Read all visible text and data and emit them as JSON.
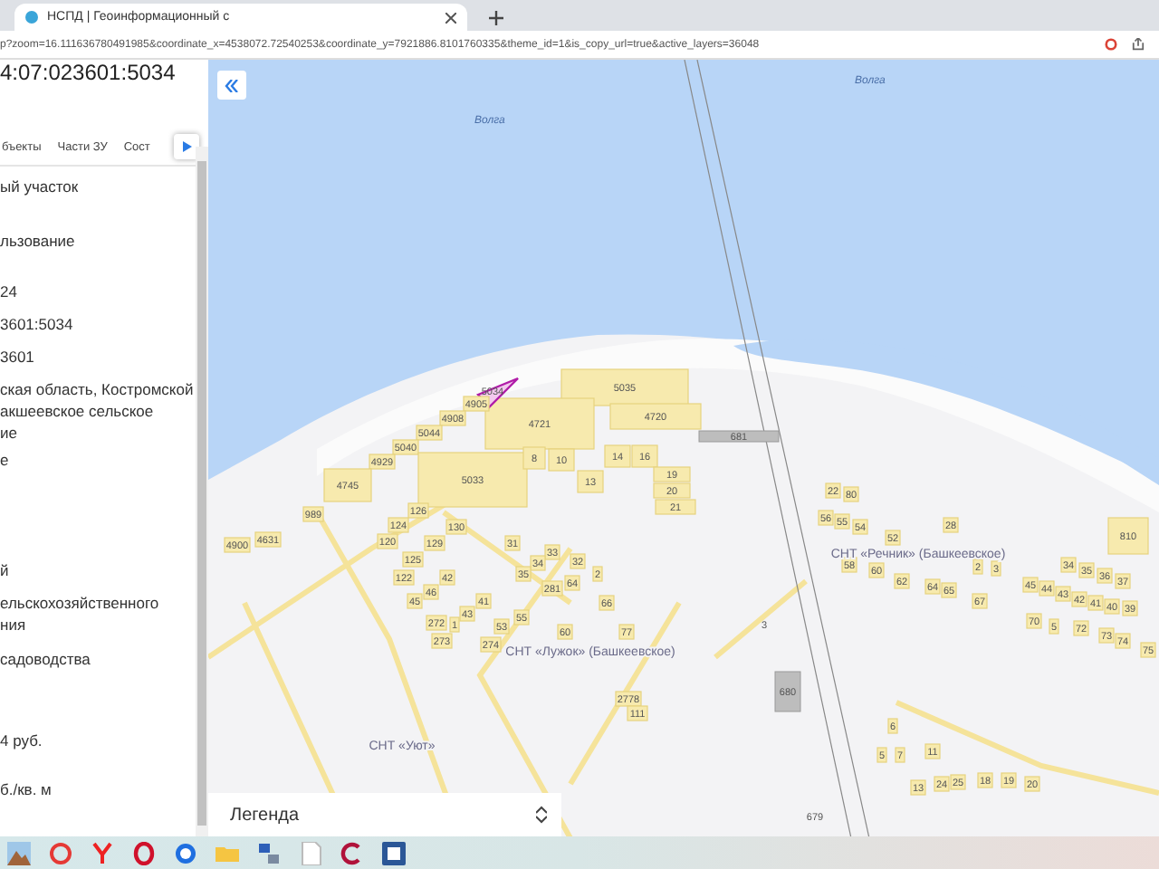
{
  "browser": {
    "tab_title": "НСПД | Геоинформационный с",
    "url": "p?zoom=16.111636780491985&coordinate_x=4538072.72540253&coordinate_y=7921886.8101760335&theme_id=1&is_copy_url=true&active_layers=36048"
  },
  "panel": {
    "title": "4:07:023601:5034",
    "tabs": [
      {
        "label": "бъекты"
      },
      {
        "label": "Части ЗУ"
      },
      {
        "label": "Сост"
      }
    ],
    "rows": [
      {
        "lines": [
          "ый участок"
        ]
      },
      {
        "lines": [
          "льзование"
        ]
      },
      {
        "lines": [
          "24"
        ]
      },
      {
        "lines": [
          "3601:5034"
        ]
      },
      {
        "lines": [
          "3601"
        ]
      },
      {
        "lines": [
          "ская область, Костромской",
          "акшеевское сельское",
          "ие"
        ]
      },
      {
        "lines": [
          "е"
        ]
      },
      {
        "lines": [
          "й"
        ]
      },
      {
        "lines": [
          "ельскохозяйственного",
          "ния"
        ]
      },
      {
        "lines": [
          "садоводства"
        ]
      },
      {
        "lines": [
          "4 руб."
        ]
      },
      {
        "lines": [
          "б./кв. м"
        ]
      }
    ]
  },
  "map": {
    "water_labels": [
      "Волга",
      "Волга"
    ],
    "parcels": [
      {
        "label": "5035",
        "kind": "parcel"
      },
      {
        "label": "4720",
        "kind": "parcel"
      },
      {
        "label": "4721",
        "kind": "parcel"
      },
      {
        "label": "5034",
        "kind": "selected"
      },
      {
        "label": "4905",
        "kind": "parcel"
      },
      {
        "label": "4908",
        "kind": "parcel"
      },
      {
        "label": "5044",
        "kind": "parcel"
      },
      {
        "label": "5040",
        "kind": "parcel"
      },
      {
        "label": "4929",
        "kind": "parcel"
      },
      {
        "label": "4745",
        "kind": "parcel"
      },
      {
        "label": "5033",
        "kind": "parcel"
      },
      {
        "label": "8",
        "kind": "parcel"
      },
      {
        "label": "10",
        "kind": "parcel"
      },
      {
        "label": "13",
        "kind": "parcel"
      },
      {
        "label": "14",
        "kind": "parcel"
      },
      {
        "label": "16",
        "kind": "parcel"
      },
      {
        "label": "19",
        "kind": "parcel"
      },
      {
        "label": "20",
        "kind": "parcel"
      },
      {
        "label": "21",
        "kind": "parcel"
      },
      {
        "label": "681",
        "kind": "structure"
      },
      {
        "label": "989",
        "kind": "parcel"
      },
      {
        "label": "4631",
        "kind": "parcel"
      },
      {
        "label": "4900",
        "kind": "parcel"
      },
      {
        "label": "126",
        "kind": "parcel"
      },
      {
        "label": "124",
        "kind": "parcel"
      },
      {
        "label": "120",
        "kind": "parcel"
      },
      {
        "label": "130",
        "kind": "parcel"
      },
      {
        "label": "129",
        "kind": "parcel"
      },
      {
        "label": "31",
        "kind": "parcel"
      },
      {
        "label": "33",
        "kind": "parcel"
      },
      {
        "label": "34",
        "kind": "parcel"
      },
      {
        "label": "32",
        "kind": "parcel"
      },
      {
        "label": "35",
        "kind": "parcel"
      },
      {
        "label": "281",
        "kind": "parcel"
      },
      {
        "label": "64",
        "kind": "parcel"
      },
      {
        "label": "2",
        "kind": "parcel"
      },
      {
        "label": "66",
        "kind": "parcel"
      },
      {
        "label": "125",
        "kind": "parcel"
      },
      {
        "label": "122",
        "kind": "parcel"
      },
      {
        "label": "42",
        "kind": "parcel"
      },
      {
        "label": "46",
        "kind": "parcel"
      },
      {
        "label": "45",
        "kind": "parcel"
      },
      {
        "label": "41",
        "kind": "parcel"
      },
      {
        "label": "43",
        "kind": "parcel"
      },
      {
        "label": "272",
        "kind": "parcel"
      },
      {
        "label": "1",
        "kind": "parcel"
      },
      {
        "label": "273",
        "kind": "parcel"
      },
      {
        "label": "274",
        "kind": "parcel"
      },
      {
        "label": "53",
        "kind": "parcel"
      },
      {
        "label": "55",
        "kind": "parcel"
      },
      {
        "label": "60",
        "kind": "parcel"
      },
      {
        "label": "77",
        "kind": "parcel"
      },
      {
        "label": "22",
        "kind": "parcel"
      },
      {
        "label": "80",
        "kind": "parcel"
      },
      {
        "label": "56",
        "kind": "parcel"
      },
      {
        "label": "55",
        "kind": "parcel"
      },
      {
        "label": "54",
        "kind": "parcel"
      },
      {
        "label": "52",
        "kind": "parcel"
      },
      {
        "label": "28",
        "kind": "parcel"
      },
      {
        "label": "58",
        "kind": "parcel"
      },
      {
        "label": "60",
        "kind": "parcel"
      },
      {
        "label": "62",
        "kind": "parcel"
      },
      {
        "label": "64",
        "kind": "parcel"
      },
      {
        "label": "65",
        "kind": "parcel"
      },
      {
        "label": "67",
        "kind": "parcel"
      },
      {
        "label": "2",
        "kind": "parcel"
      },
      {
        "label": "3",
        "kind": "parcel"
      },
      {
        "label": "34",
        "kind": "parcel"
      },
      {
        "label": "35",
        "kind": "parcel"
      },
      {
        "label": "36",
        "kind": "parcel"
      },
      {
        "label": "37",
        "kind": "parcel"
      },
      {
        "label": "45",
        "kind": "parcel"
      },
      {
        "label": "44",
        "kind": "parcel"
      },
      {
        "label": "43",
        "kind": "parcel"
      },
      {
        "label": "42",
        "kind": "parcel"
      },
      {
        "label": "41",
        "kind": "parcel"
      },
      {
        "label": "40",
        "kind": "parcel"
      },
      {
        "label": "39",
        "kind": "parcel"
      },
      {
        "label": "70",
        "kind": "parcel"
      },
      {
        "label": "5",
        "kind": "parcel"
      },
      {
        "label": "72",
        "kind": "parcel"
      },
      {
        "label": "73",
        "kind": "parcel"
      },
      {
        "label": "74",
        "kind": "parcel"
      },
      {
        "label": "75",
        "kind": "parcel"
      },
      {
        "label": "810",
        "kind": "parcel"
      },
      {
        "label": "680",
        "kind": "structure"
      },
      {
        "label": "6",
        "kind": "parcel"
      },
      {
        "label": "5",
        "kind": "parcel"
      },
      {
        "label": "7",
        "kind": "parcel"
      },
      {
        "label": "11",
        "kind": "parcel"
      },
      {
        "label": "13",
        "kind": "parcel"
      },
      {
        "label": "24",
        "kind": "parcel"
      },
      {
        "label": "25",
        "kind": "parcel"
      },
      {
        "label": "18",
        "kind": "parcel"
      },
      {
        "label": "19",
        "kind": "parcel"
      },
      {
        "label": "20",
        "kind": "parcel"
      },
      {
        "label": "2778",
        "kind": "parcel"
      },
      {
        "label": "111",
        "kind": "parcel"
      },
      {
        "label": "679",
        "kind": "number"
      },
      {
        "label": "3",
        "kind": "number"
      }
    ],
    "area_labels": [
      "СНТ «Лужок» (Башкеевское)",
      "СНТ «Речник» (Башкеевское)",
      "СНТ «Уют»"
    ],
    "legend": {
      "label": "Легенда"
    }
  }
}
